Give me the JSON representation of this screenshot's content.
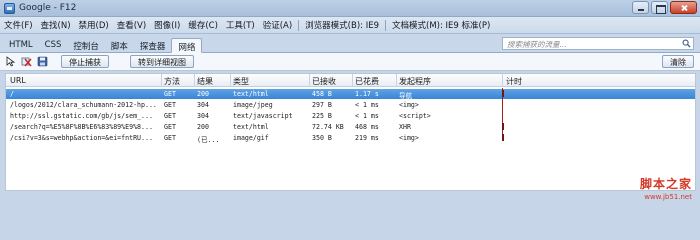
{
  "window": {
    "title": "Google - F12"
  },
  "menu": {
    "items": [
      "文件(F)",
      "查找(N)",
      "禁用(D)",
      "查看(V)",
      "图像(I)",
      "缓存(C)",
      "工具(T)",
      "验证(A)"
    ],
    "browser_mode": "浏览器模式(B): IE9",
    "document_mode": "文档模式(M): IE9 标准(P)"
  },
  "tabs": [
    {
      "label": "HTML"
    },
    {
      "label": "CSS"
    },
    {
      "label": "控制台"
    },
    {
      "label": "脚本"
    },
    {
      "label": "探查器"
    },
    {
      "label": "网络",
      "active": true
    }
  ],
  "search": {
    "placeholder": "搜索捕获的流量..."
  },
  "toolbar": {
    "stop_label": "停止捕获",
    "detail_label": "转到详细视图",
    "clear_label": "清除"
  },
  "grid": {
    "columns": [
      "URL",
      "方法",
      "结果",
      "类型",
      "已接收",
      "已花费",
      "发起程序",
      "计时"
    ],
    "rows": [
      {
        "url": "/",
        "method": "GET",
        "result": "200",
        "type": "text/html",
        "received": "458 B",
        "taken": "1.17 s",
        "initiator": "导航",
        "selected": true
      },
      {
        "url": "/logos/2012/clara_schumann-2012-hp...",
        "method": "GET",
        "result": "304",
        "type": "image/jpeg",
        "received": "297 B",
        "taken": "< 1 ms",
        "initiator": "<img>"
      },
      {
        "url": "http://ssl.gstatic.com/gb/js/sem_...",
        "method": "GET",
        "result": "304",
        "type": "text/javascript",
        "received": "225 B",
        "taken": "< 1 ms",
        "initiator": "<script>"
      },
      {
        "url": "/search?q=%E5%8F%8B%E6%83%89%E9%8...",
        "method": "GET",
        "result": "200",
        "type": "text/html",
        "received": "72.74 KB",
        "taken": "468 ms",
        "initiator": "XHR"
      },
      {
        "url": "/csi?v=3&s=webhp&action=&ei=fntRU...",
        "method": "GET",
        "result": "(已...",
        "type": "image/gif",
        "received": "350 B",
        "taken": "219 ms",
        "initiator": "<img>"
      }
    ]
  },
  "watermark": {
    "text": "脚本之家",
    "sub": "www.jb51.net"
  },
  "colors": {
    "selection": "#3a84d6",
    "timeline": "#a21e1e"
  }
}
